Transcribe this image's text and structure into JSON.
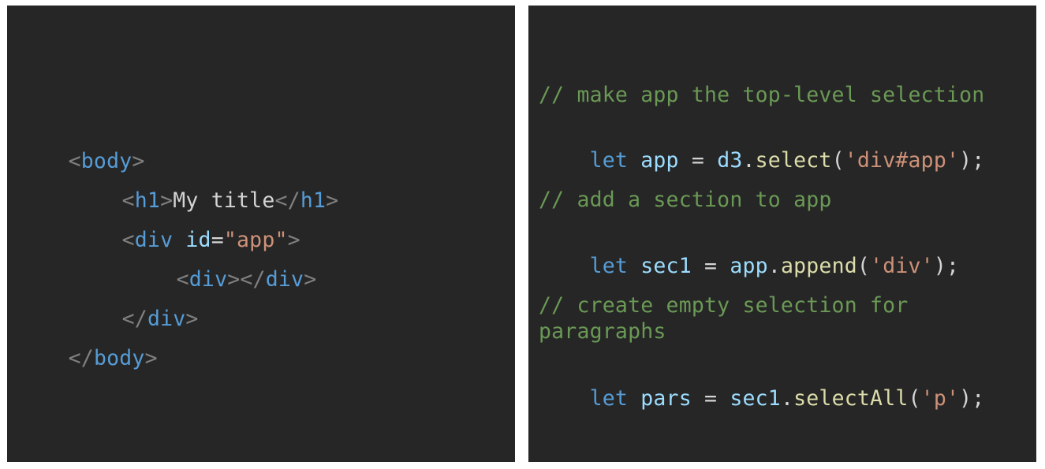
{
  "colors": {
    "background": "#262626",
    "punctuation": "#808080",
    "tag": "#569cd6",
    "text": "#d4d4d4",
    "attribute": "#9cdcfe",
    "string": "#ce9178",
    "comment": "#6a9955",
    "keyword": "#569cd6",
    "variable": "#9cdcfe",
    "function": "#dcdcaa"
  },
  "html_panel": {
    "line1": {
      "open": "<",
      "tag": "body",
      "close": ">"
    },
    "line2": {
      "open": "<",
      "tag": "h1",
      "close": ">",
      "content": "My title",
      "end_open": "</",
      "end_tag": "h1",
      "end_close": ">"
    },
    "line3": {
      "open": "<",
      "tag": "div",
      "space": " ",
      "attr": "id",
      "eq": "=",
      "value": "\"app\"",
      "close": ">"
    },
    "line4": {
      "open": "<",
      "tag": "div",
      "close": ">",
      "end_open": "</",
      "end_tag": "div",
      "end_close": ">"
    },
    "line5": {
      "end_open": "</",
      "end_tag": "div",
      "end_close": ">"
    },
    "line6": {
      "end_open": "</",
      "end_tag": "body",
      "end_close": ">"
    }
  },
  "js_panel": {
    "comment1": "// make app the top-level selection",
    "code1": {
      "kw": "let",
      "var": "app",
      "op": "=",
      "obj": "d3",
      "dot": ".",
      "fn": "select",
      "lp": "(",
      "str": "'div#app'",
      "rp": ");"
    },
    "comment2": "// add a section to app",
    "code2": {
      "kw": "let",
      "var": "sec1",
      "op": "=",
      "obj": "app",
      "dot": ".",
      "fn": "append",
      "lp": "(",
      "str": "'div'",
      "rp": ");"
    },
    "comment3a": "// create empty selection for",
    "comment3b": "paragraphs",
    "code3": {
      "kw": "let",
      "var": "pars",
      "op": "=",
      "obj": "sec1",
      "dot": ".",
      "fn": "selectAll",
      "lp": "(",
      "str": "'p'",
      "rp": ");"
    }
  }
}
